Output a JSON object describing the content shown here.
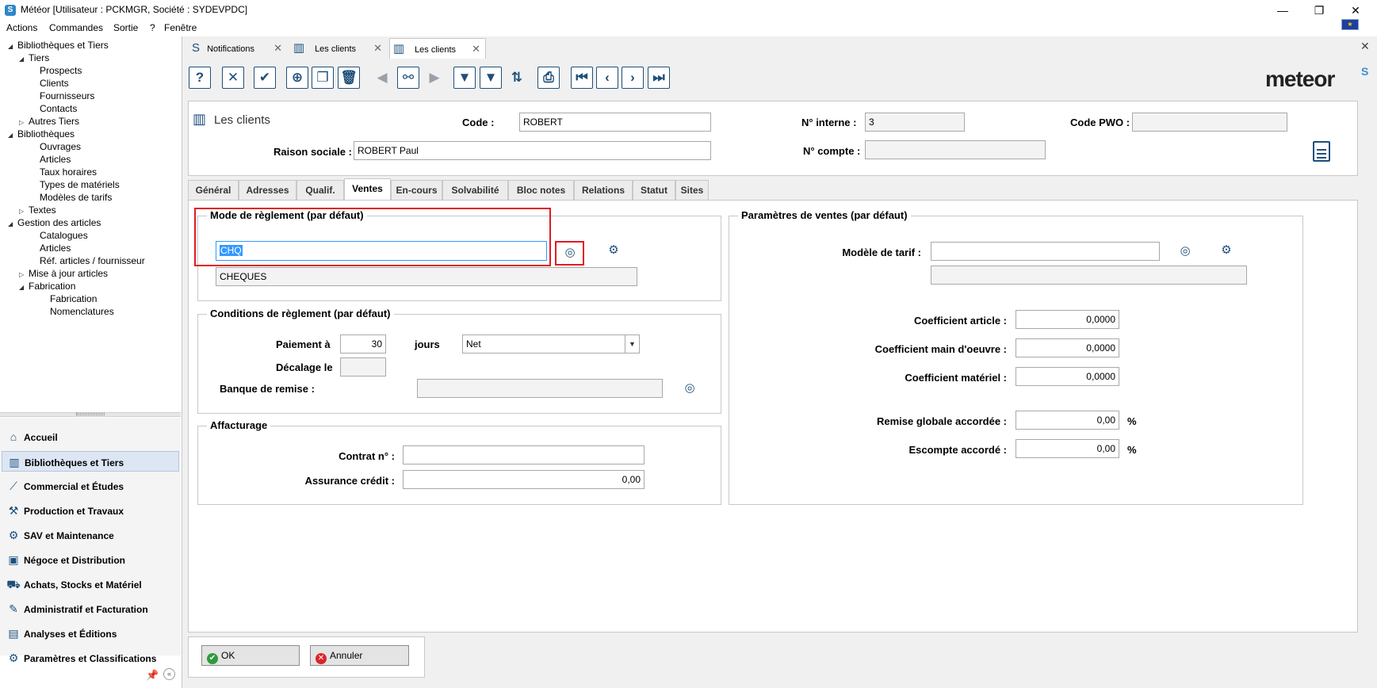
{
  "window": {
    "title": "Météor [Utilisateur : PCKMGR, Société : SYDEVPDC]",
    "min_icon": "—",
    "max_icon": "❐",
    "close_icon": "✕"
  },
  "menu": [
    "Actions",
    "Commandes",
    "Sortie",
    "?",
    "Fenêtre"
  ],
  "tree": [
    {
      "label": "Bibliothèques et Tiers",
      "level": 0,
      "toggle": "◢"
    },
    {
      "label": "Tiers",
      "level": 1,
      "toggle": "◢"
    },
    {
      "label": "Prospects",
      "level": 2,
      "toggle": ""
    },
    {
      "label": "Clients",
      "level": 2,
      "toggle": ""
    },
    {
      "label": "Fournisseurs",
      "level": 2,
      "toggle": ""
    },
    {
      "label": "Contacts",
      "level": 2,
      "toggle": ""
    },
    {
      "label": "Autres Tiers",
      "level": 1,
      "toggle": "▷"
    },
    {
      "label": "Bibliothèques",
      "level": 0,
      "toggle": "◢"
    },
    {
      "label": "Ouvrages",
      "level": 2,
      "toggle": ""
    },
    {
      "label": "Articles",
      "level": 2,
      "toggle": ""
    },
    {
      "label": "Taux horaires",
      "level": 2,
      "toggle": ""
    },
    {
      "label": "Types de matériels",
      "level": 2,
      "toggle": ""
    },
    {
      "label": "Modèles de tarifs",
      "level": 2,
      "toggle": ""
    },
    {
      "label": "Textes",
      "level": 1,
      "toggle": "▷"
    },
    {
      "label": "Gestion des articles",
      "level": 0,
      "toggle": "◢"
    },
    {
      "label": "Catalogues",
      "level": 2,
      "toggle": ""
    },
    {
      "label": "Articles",
      "level": 2,
      "toggle": ""
    },
    {
      "label": "Réf. articles / fournisseur",
      "level": 2,
      "toggle": ""
    },
    {
      "label": "Mise à jour articles",
      "level": 1,
      "toggle": "▷"
    },
    {
      "label": "Fabrication",
      "level": 1,
      "toggle": "◢"
    },
    {
      "label": "Fabrication",
      "level": 3,
      "toggle": ""
    },
    {
      "label": "Nomenclatures",
      "level": 3,
      "toggle": ""
    }
  ],
  "modules": [
    {
      "label": "Accueil",
      "icon": "⌂",
      "active": false
    },
    {
      "label": "Bibliothèques et Tiers",
      "icon": "▥",
      "active": true
    },
    {
      "label": "Commercial et Études",
      "icon": "⟋",
      "active": false
    },
    {
      "label": "Production et Travaux",
      "icon": "⚒",
      "active": false
    },
    {
      "label": "SAV et Maintenance",
      "icon": "⚙",
      "active": false
    },
    {
      "label": "Négoce et Distribution",
      "icon": "▣",
      "active": false
    },
    {
      "label": "Achats, Stocks et Matériel",
      "icon": "⛟",
      "active": false
    },
    {
      "label": "Administratif et Facturation",
      "icon": "✎",
      "active": false
    },
    {
      "label": "Analyses et Éditions",
      "icon": "▤",
      "active": false
    },
    {
      "label": "Paramètres et Classifications",
      "icon": "⚙",
      "active": false
    }
  ],
  "doc_tabs": [
    {
      "label": "Notifications",
      "icon": "S",
      "active": false
    },
    {
      "label": "Les clients",
      "icon": "▥",
      "active": false
    },
    {
      "label": "Les clients",
      "icon": "▥",
      "active": true
    }
  ],
  "toolbar": [
    {
      "name": "help-icon",
      "glyph": "?",
      "style": ""
    },
    {
      "name": "cancel-icon",
      "glyph": "✕",
      "style": ""
    },
    {
      "name": "validate-icon",
      "glyph": "✔",
      "style": ""
    },
    {
      "name": "add-icon",
      "glyph": "⊕",
      "style": ""
    },
    {
      "name": "copy-icon",
      "glyph": "❐",
      "style": ""
    },
    {
      "name": "delete-icon",
      "glyph": "🗑",
      "style": ""
    },
    {
      "name": "previous-record-icon",
      "glyph": "◀",
      "style": "grey noborder"
    },
    {
      "name": "search-binoculars-icon",
      "glyph": "⚯",
      "style": ""
    },
    {
      "name": "next-record-icon",
      "glyph": "▶",
      "style": "grey noborder"
    },
    {
      "name": "filter-icon",
      "glyph": "▼",
      "style": ""
    },
    {
      "name": "remove-filter-icon",
      "glyph": "▼",
      "style": ""
    },
    {
      "name": "sort-icon",
      "glyph": "⇅",
      "style": "noborder"
    },
    {
      "name": "print-icon",
      "glyph": "⎙",
      "style": ""
    },
    {
      "name": "first-record-icon",
      "glyph": "⏮",
      "style": ""
    },
    {
      "name": "prev-icon",
      "glyph": "‹",
      "style": ""
    },
    {
      "name": "next-icon",
      "glyph": "›",
      "style": ""
    },
    {
      "name": "last-record-icon",
      "glyph": "⏭",
      "style": ""
    }
  ],
  "logo": {
    "text": "meteor",
    "mark": "S"
  },
  "header": {
    "title": "Les clients",
    "code_label": "Code :",
    "code_value": "ROBERT",
    "raison_label": "Raison sociale :",
    "raison_value": "ROBERT Paul",
    "interne_label": "N° interne :",
    "interne_value": "3",
    "compte_label": "N° compte :",
    "compte_value": "",
    "pwo_label": "Code PWO :",
    "pwo_value": ""
  },
  "section_tabs": [
    {
      "label": "Général",
      "active": false
    },
    {
      "label": "Adresses",
      "active": false
    },
    {
      "label": "Qualif.",
      "active": false
    },
    {
      "label": "Ventes",
      "active": true
    },
    {
      "label": "En-cours",
      "active": false
    },
    {
      "label": "Solvabilité",
      "active": false
    },
    {
      "label": "Bloc notes",
      "active": false
    },
    {
      "label": "Relations",
      "active": false
    },
    {
      "label": "Statut",
      "active": false
    },
    {
      "label": "Sites",
      "active": false
    }
  ],
  "mode_reglement": {
    "title": "Mode de règlement (par défaut)",
    "code": "CHQ",
    "description": "CHEQUES"
  },
  "conditions": {
    "title": "Conditions de règlement (par défaut)",
    "paiement_label": "Paiement à",
    "paiement_value": "30",
    "jours_label": "jours",
    "terme_value": "Net",
    "decalage_label": "Décalage le",
    "decalage_value": "",
    "banque_label": "Banque de remise :",
    "banque_value": ""
  },
  "affacturage": {
    "title": "Affacturage",
    "contrat_label": "Contrat n° :",
    "contrat_value": "",
    "assurance_label": "Assurance crédit :",
    "assurance_value": "0,00"
  },
  "ventes": {
    "title": "Paramètres de ventes (par défaut)",
    "modele_label": "Modèle de tarif :",
    "modele_value": "",
    "modele_desc": "",
    "coef_article_label": "Coefficient article :",
    "coef_article_value": "0,0000",
    "coef_mo_label": "Coefficient main d'oeuvre :",
    "coef_mo_value": "0,0000",
    "coef_materiel_label": "Coefficient matériel :",
    "coef_materiel_value": "0,0000",
    "remise_label": "Remise globale accordée :",
    "remise_value": "0,00",
    "escompte_label": "Escompte accordé :",
    "escompte_value": "0,00",
    "percent": "%"
  },
  "buttons": {
    "ok": "OK",
    "annuler": "Annuler"
  },
  "colors": {
    "highlight": "#e11b22",
    "accent": "#1f4f7a",
    "selection": "#3399ff"
  }
}
